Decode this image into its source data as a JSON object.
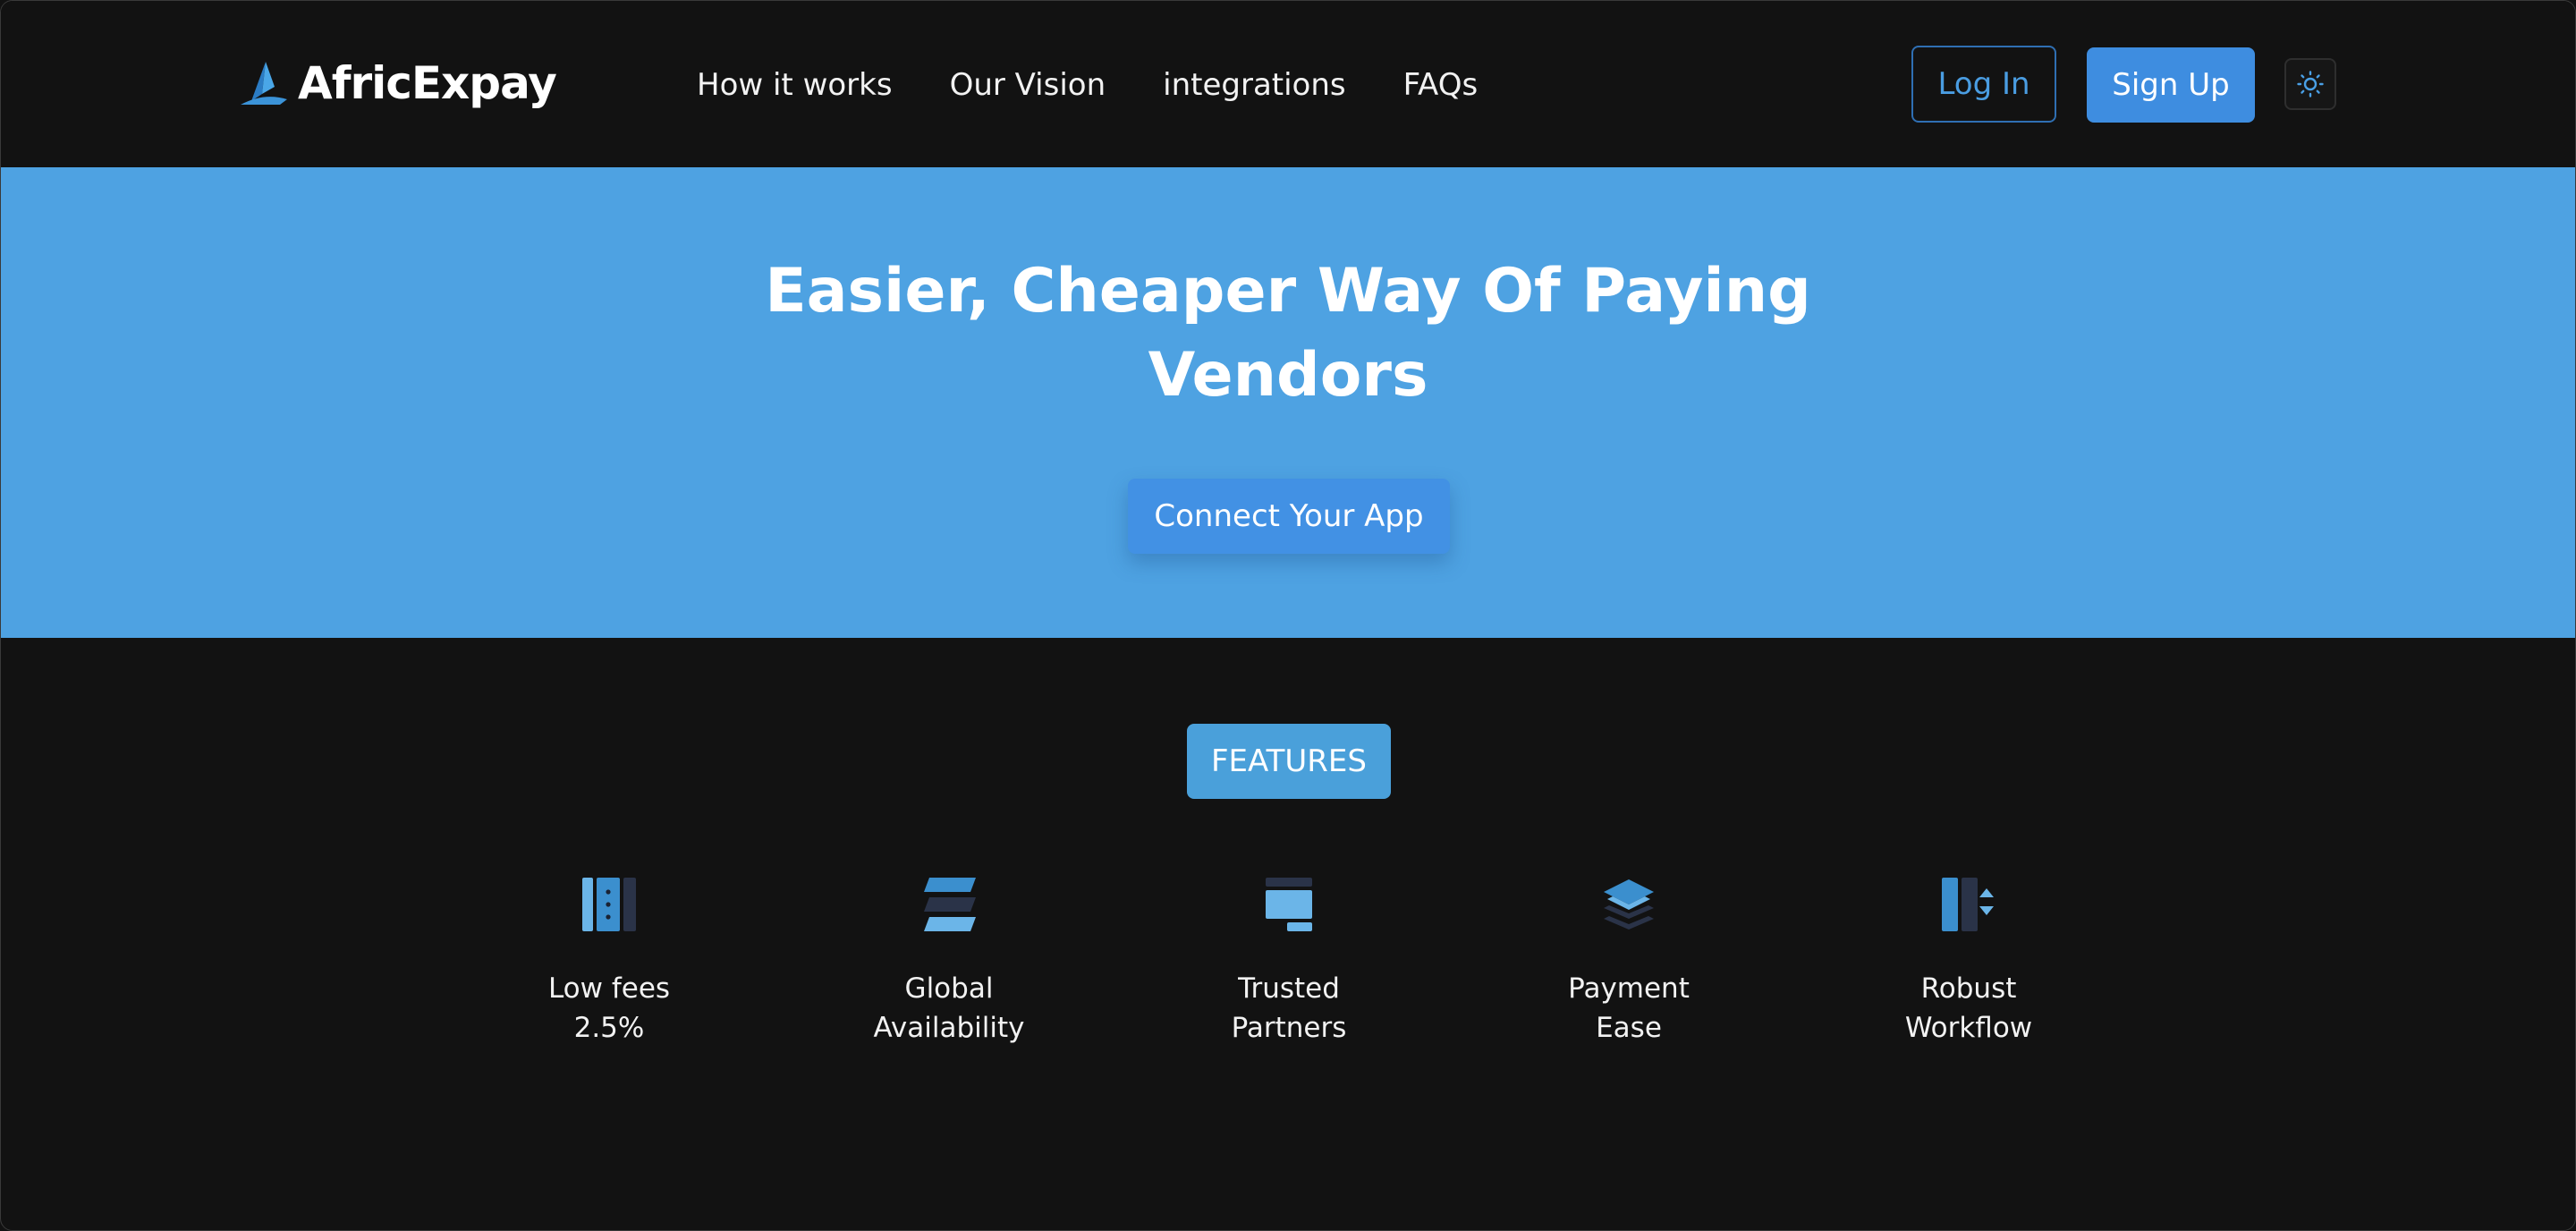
{
  "header": {
    "logo_text": "AfricExpay",
    "logo_icon": "logo-mark-icon",
    "nav": [
      {
        "label": "How it works"
      },
      {
        "label": "Our Vision"
      },
      {
        "label": "integrations"
      },
      {
        "label": "FAQs"
      }
    ],
    "login_label": "Log In",
    "signup_label": "Sign Up",
    "theme_icon": "sun-icon"
  },
  "hero": {
    "title_line1": "Easier, Cheaper Way Of Paying",
    "title_line2": "Vendors",
    "cta_label": "Connect Your App"
  },
  "features": {
    "badge": "FEATURES",
    "items": [
      {
        "icon": "columns-icon",
        "line1": "Low fees",
        "line2": "2.5%"
      },
      {
        "icon": "stack-bars-icon",
        "line1": "Global",
        "line2": "Availability"
      },
      {
        "icon": "window-icon",
        "line1": "Trusted",
        "line2": "Partners"
      },
      {
        "icon": "layers-icon",
        "line1": "Payment",
        "line2": "Ease"
      },
      {
        "icon": "sort-panel-icon",
        "line1": "Robust",
        "line2": "Workflow"
      }
    ]
  },
  "colors": {
    "background": "#121212",
    "hero": "#4ea2e2",
    "primary_button": "#3e8de0",
    "badge": "#4aa0da",
    "icon_light": "#6bb5e8",
    "icon_dark": "#2a3348"
  }
}
